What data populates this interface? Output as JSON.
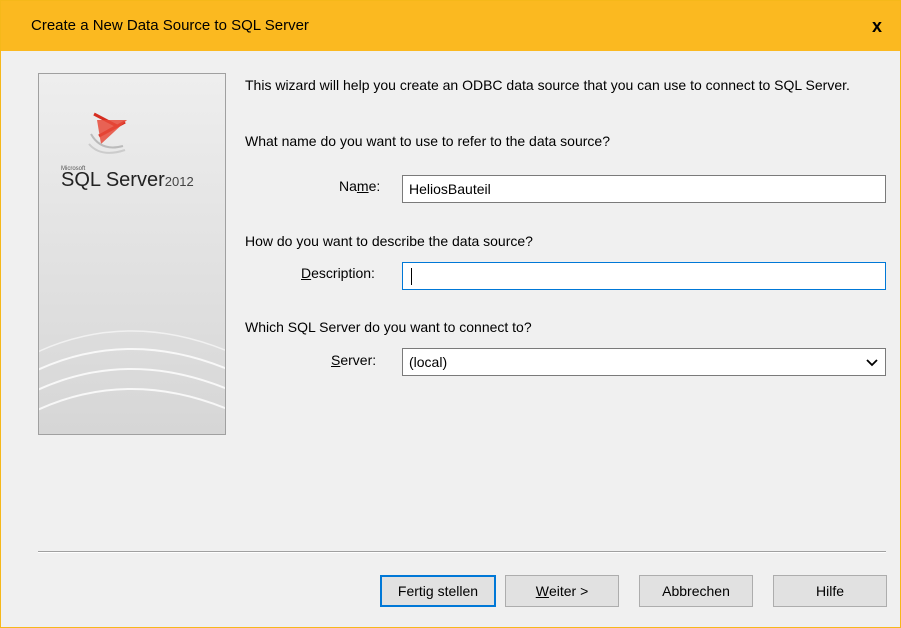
{
  "window": {
    "title": "Create a New Data Source to SQL Server",
    "close_glyph": "x",
    "accent": "#fbb920"
  },
  "side_panel": {
    "brand_small": "Microsoft",
    "brand_name": "SQL Server",
    "brand_year": "2012",
    "logo_icon": "sql-server-logo-icon"
  },
  "content": {
    "intro": "This wizard will help you create an ODBC data source that you can use to connect to SQL Server.",
    "name_question": "What name do you want to use to refer to the data source?",
    "name_label_pre": "Na",
    "name_label_mn": "m",
    "name_label_post": "e:",
    "name_value": "HeliosBauteil",
    "description_question": "How do you want to describe the data source?",
    "description_label_mn": "D",
    "description_label_post": "escription:",
    "description_value": "",
    "server_question": "Which SQL Server do you want to connect to?",
    "server_label_mn": "S",
    "server_label_post": "erver:",
    "server_value": "(local)"
  },
  "buttons": {
    "finish": "Fertig stellen",
    "next_mn": "W",
    "next_post": "eiter >",
    "cancel": "Abbrechen",
    "help": "Hilfe"
  }
}
